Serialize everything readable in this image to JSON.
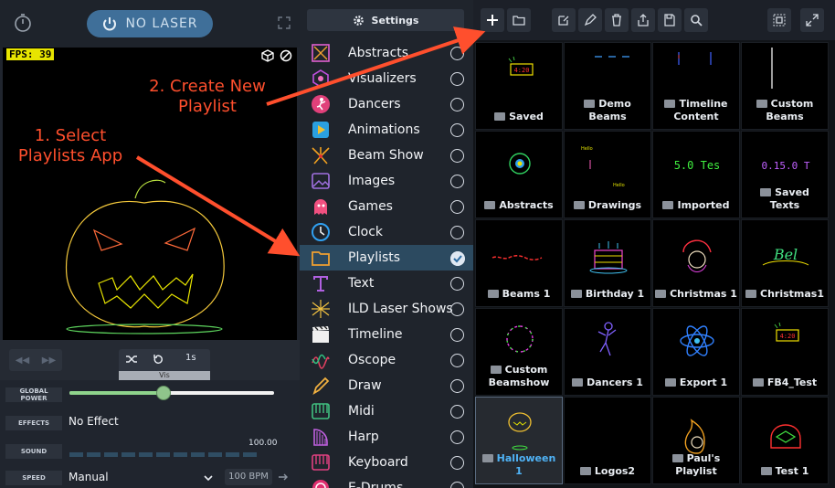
{
  "left_panel": {
    "laser_button_label": "NO LASER",
    "fps_label": "FPS: 39",
    "duration_label": "1s",
    "vis_label": "Vis",
    "global_power_label": "GLOBAL POWER",
    "global_power_level": 0.46,
    "effects_label": "EFFECTS",
    "effects_value": "No Effect",
    "sound_label": "SOUND",
    "sound_value": "100.00",
    "speed_label": "SPEED",
    "speed_value": "Manual",
    "bpm_value": "100 BPM"
  },
  "menu": {
    "settings_label": "Settings",
    "items": [
      {
        "label": "Abstracts",
        "icon": "abstracts-icon",
        "selected": false
      },
      {
        "label": "Visualizers",
        "icon": "visualizers-icon",
        "selected": false
      },
      {
        "label": "Dancers",
        "icon": "dancers-icon",
        "selected": false
      },
      {
        "label": "Animations",
        "icon": "animations-icon",
        "selected": false
      },
      {
        "label": "Beam Show",
        "icon": "beam-show-icon",
        "selected": false
      },
      {
        "label": "Images",
        "icon": "images-icon",
        "selected": false
      },
      {
        "label": "Games",
        "icon": "games-icon",
        "selected": false
      },
      {
        "label": "Clock",
        "icon": "clock-icon",
        "selected": false
      },
      {
        "label": "Playlists",
        "icon": "playlists-icon",
        "selected": true
      },
      {
        "label": "Text",
        "icon": "text-icon",
        "selected": false
      },
      {
        "label": "ILD Laser Shows",
        "icon": "ild-icon",
        "selected": false
      },
      {
        "label": "Timeline",
        "icon": "timeline-icon",
        "selected": false
      },
      {
        "label": "Oscope",
        "icon": "oscope-icon",
        "selected": false
      },
      {
        "label": "Draw",
        "icon": "draw-icon",
        "selected": false
      },
      {
        "label": "Midi",
        "icon": "midi-icon",
        "selected": false
      },
      {
        "label": "Harp",
        "icon": "harp-icon",
        "selected": false
      },
      {
        "label": "Keyboard",
        "icon": "keyboard-icon",
        "selected": false
      },
      {
        "label": "E-Drums",
        "icon": "drums-icon",
        "selected": false
      }
    ]
  },
  "grid": {
    "items": [
      {
        "label": "Saved",
        "thumb": "clock-thumb"
      },
      {
        "label": "Demo Beams",
        "thumb": "dashes-thumb"
      },
      {
        "label": "Timeline Content",
        "thumb": "lines-thumb"
      },
      {
        "label": "Custom Beams",
        "thumb": "vline-thumb"
      },
      {
        "label": "Abstracts",
        "thumb": "globe-thumb"
      },
      {
        "label": "Drawings",
        "thumb": "sparse-thumb"
      },
      {
        "label": "Imported",
        "thumb": "text50-thumb"
      },
      {
        "label": "Saved Texts",
        "thumb": "text016-thumb"
      },
      {
        "label": "Beams 1",
        "thumb": "wave-thumb"
      },
      {
        "label": "Birthday 1",
        "thumb": "cake-thumb"
      },
      {
        "label": "Christmas 1",
        "thumb": "santa-thumb"
      },
      {
        "label": "Christmas1",
        "thumb": "script-thumb"
      },
      {
        "label": "Custom Beamshow",
        "thumb": "ring-thumb"
      },
      {
        "label": "Dancers 1",
        "thumb": "dancer-thumb"
      },
      {
        "label": "Export 1",
        "thumb": "atom-thumb"
      },
      {
        "label": "FB4_Test",
        "thumb": "clock-thumb"
      },
      {
        "label": "Halloween 1",
        "thumb": "pumpkin-thumb",
        "selected": true
      },
      {
        "label": "Logos2",
        "thumb": "none"
      },
      {
        "label": "Paul's Playlist",
        "thumb": "flame-thumb"
      },
      {
        "label": "Test 1",
        "thumb": "helmet-thumb"
      }
    ]
  },
  "annotations": {
    "step1": "1. Select Playlists App",
    "step2": "2. Create New Playlist"
  },
  "colors": {
    "accent": "#3f6f99",
    "annotation": "#ff4f2d",
    "selected_item": "#2c4a60"
  }
}
